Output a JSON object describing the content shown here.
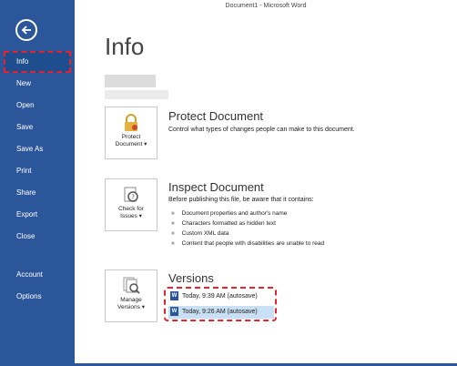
{
  "window": {
    "title": "Document1 - Microsoft Word"
  },
  "sidebar": {
    "back_icon": "back-arrow-icon",
    "items": [
      {
        "label": "Info",
        "active": true
      },
      {
        "label": "New"
      },
      {
        "label": "Open"
      },
      {
        "label": "Save"
      },
      {
        "label": "Save As"
      },
      {
        "label": "Print"
      },
      {
        "label": "Share"
      },
      {
        "label": "Export"
      },
      {
        "label": "Close"
      }
    ],
    "lower_items": [
      {
        "label": "Account"
      },
      {
        "label": "Options"
      }
    ]
  },
  "main": {
    "title": "Info",
    "protect": {
      "button_line1": "Protect",
      "button_line2": "Document",
      "title": "Protect Document",
      "desc": "Control what types of changes people can make to this document."
    },
    "inspect": {
      "button_line1": "Check for",
      "button_line2": "Issues",
      "title": "Inspect Document",
      "desc": "Before publishing this file, be aware that it contains:",
      "bullets": [
        "Document properties and author's name",
        "Characters formatted as hidden text",
        "Custom XML data",
        "Content that people with disabilities are unable to read"
      ]
    },
    "versions": {
      "button_line1": "Manage",
      "button_line2": "Versions",
      "title": "Versions",
      "items": [
        {
          "label": "Today, 9:39 AM (autosave)"
        },
        {
          "label": "Today, 9:26 AM (autosave)",
          "selected": true
        }
      ]
    }
  },
  "colors": {
    "accent": "#2b579a",
    "highlight": "#e8222c",
    "selection": "#c9dff3"
  }
}
